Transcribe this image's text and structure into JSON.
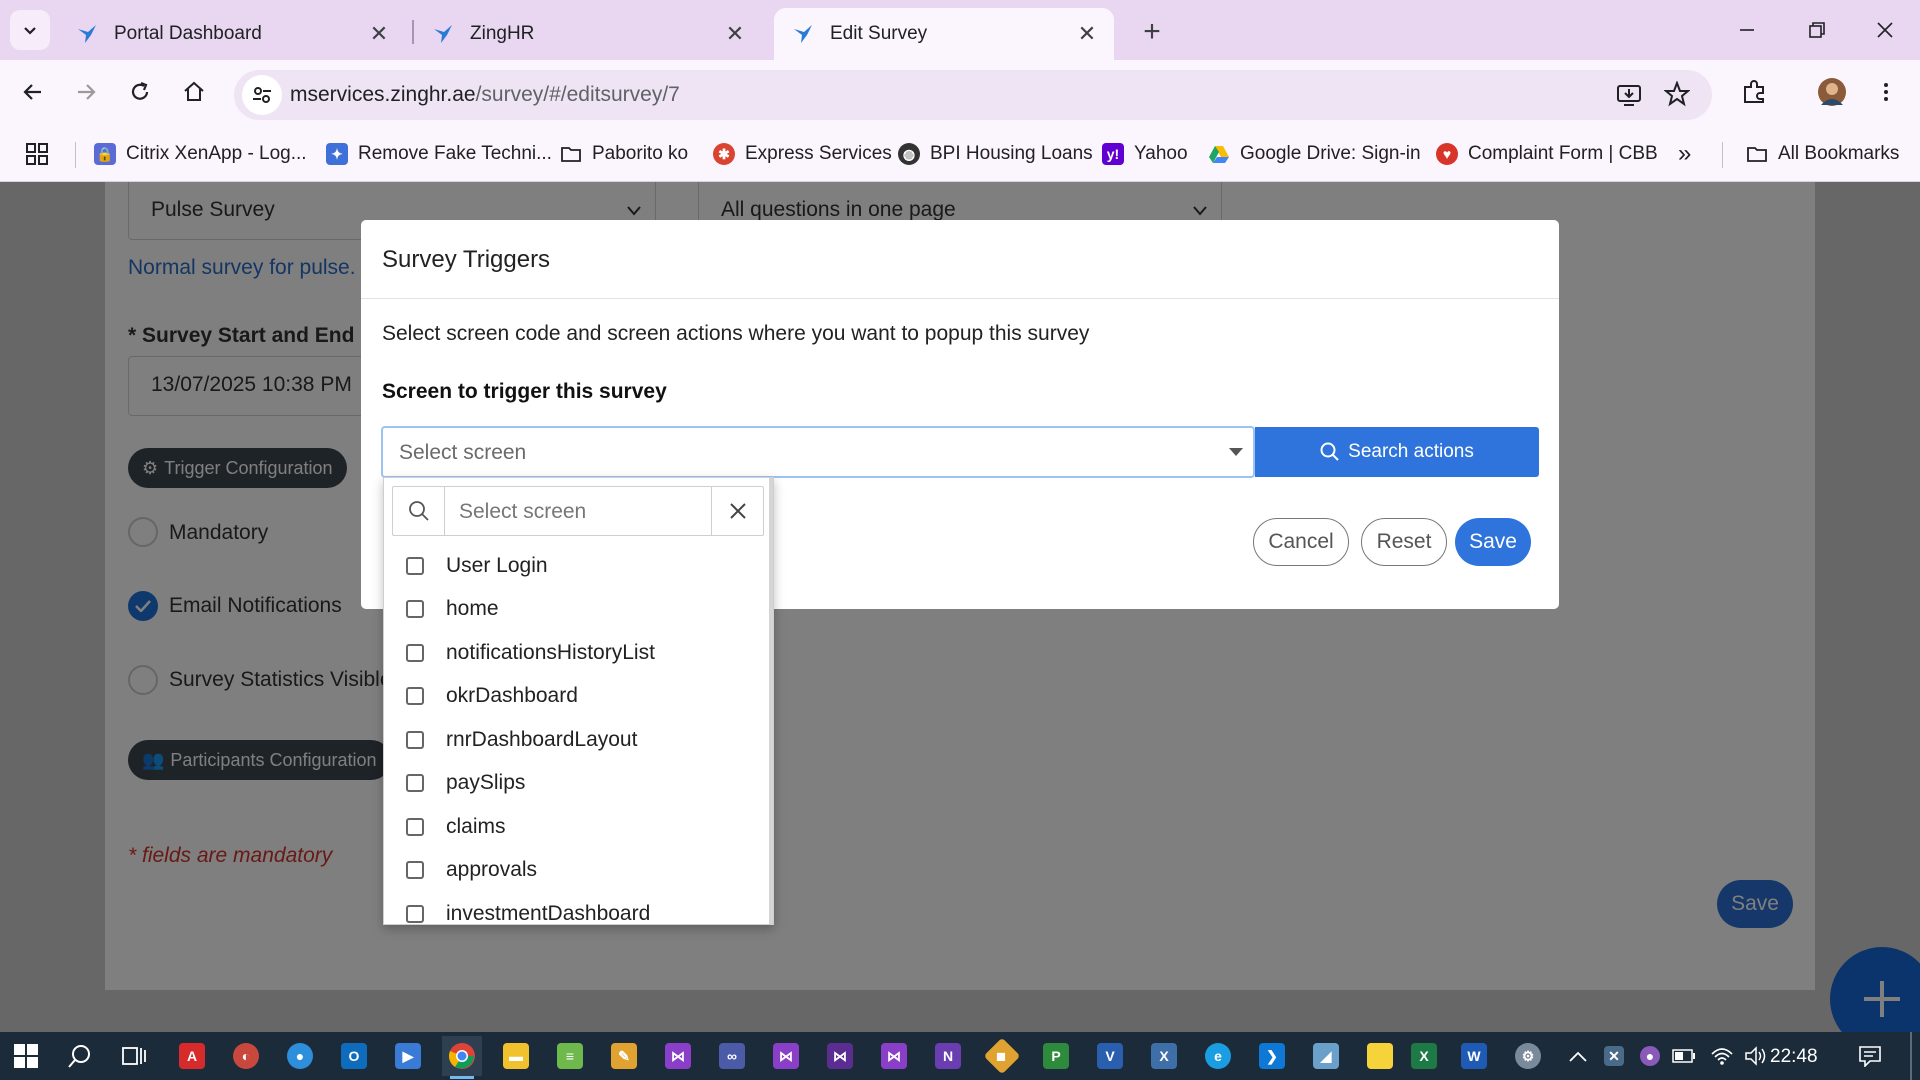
{
  "tabs": [
    {
      "label": "Portal Dashboard",
      "active": false
    },
    {
      "label": "ZingHR",
      "active": false
    },
    {
      "label": "Edit Survey",
      "active": true
    }
  ],
  "omnibox": {
    "host": "mservices.zinghr.ae",
    "path": "/survey/#/editsurvey/7"
  },
  "bookmarks": [
    {
      "label": "Citrix XenApp - Log...",
      "icon": "lock-icon",
      "color": "#5b6bd6"
    },
    {
      "label": "Remove Fake Techni...",
      "icon": "puzzle-icon",
      "color": "#3f6fd8"
    },
    {
      "label": "Paborito ko",
      "icon": "folder-icon",
      "color": "#444444"
    },
    {
      "label": "Express Services",
      "icon": "crab-icon",
      "color": "#d9432f"
    },
    {
      "label": "BPI Housing Loans",
      "icon": "globe-icon",
      "color": "#333333"
    },
    {
      "label": "Yahoo",
      "icon": "yahoo-icon",
      "color": "#6001d2"
    },
    {
      "label": "Google Drive: Sign-in",
      "icon": "drive-icon",
      "color": "#1fa463"
    },
    {
      "label": "Complaint Form | CBB",
      "icon": "shield-icon",
      "color": "#d8342a"
    }
  ],
  "bookmarks_overflow": "»",
  "all_bookmarks": "All Bookmarks",
  "background_page": {
    "survey_type": "Pulse Survey",
    "layout_option": "All questions in one page",
    "survey_type_description": "Normal survey for pulse.",
    "date_label": "* Survey Start and End Da",
    "start_date": "13/07/2025 10:38 PM",
    "trigger_config": "Trigger Configuration",
    "mandatory": "Mandatory",
    "email_notifications": "Email Notifications",
    "survey_statistics": "Survey Statistics Visible",
    "participants_config": "Participants Configuration",
    "fields_mandatory": "* fields are mandatory",
    "save": "Save"
  },
  "modal": {
    "title": "Survey Triggers",
    "description": "Select screen code and screen actions where you want to popup this survey",
    "subheading": "Screen to trigger this survey",
    "select_placeholder": "Select screen",
    "search_actions": "Search actions",
    "cancel": "Cancel",
    "reset": "Reset",
    "save": "Save"
  },
  "dropdown": {
    "search_placeholder": "Select screen",
    "options": [
      "User Login",
      "home",
      "notificationsHistoryList",
      "okrDashboard",
      "rnrDashboardLayout",
      "paySlips",
      "claims",
      "approvals",
      "investmentDashboard"
    ]
  },
  "taskbar": {
    "time": "22:48"
  },
  "colors": {
    "accent": "#2f74dc",
    "tab_strip": "#e9d7f1",
    "toolbar": "#fbf5fd",
    "taskbar": "#1c2b3a"
  }
}
